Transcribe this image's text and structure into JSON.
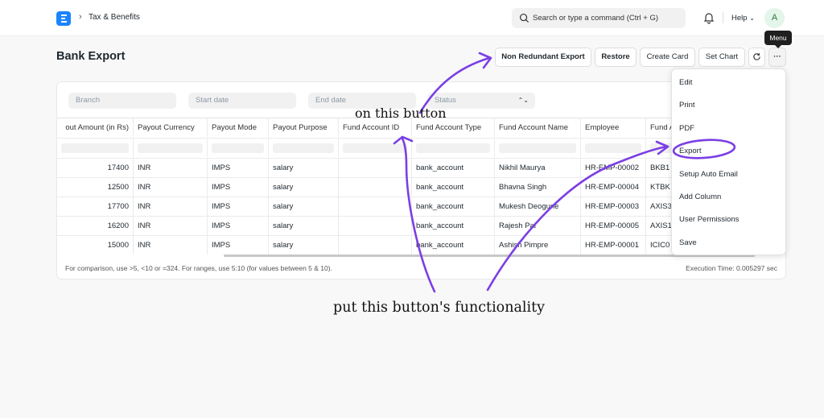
{
  "nav": {
    "breadcrumb": "Tax & Benefits",
    "search_placeholder": "Search or type a command (Ctrl + G)",
    "help_label": "Help",
    "avatar_initial": "A"
  },
  "page": {
    "title": "Bank Export"
  },
  "toolbar": {
    "non_redundant_export": "Non Redundant Export",
    "restore": "Restore",
    "create_card": "Create Card",
    "set_chart": "Set Chart",
    "more_label": "···",
    "tooltip": "Menu"
  },
  "filters": {
    "branch": "Branch",
    "start_date": "Start date",
    "end_date": "End date",
    "status": "Status"
  },
  "table": {
    "columns": [
      "out Amount (in Rs)",
      "Payout Currency",
      "Payout Mode",
      "Payout Purpose",
      "Fund Account ID",
      "Fund Account Type",
      "Fund Account Name",
      "Employee",
      "Fund A"
    ],
    "rows": [
      [
        "17400",
        "INR",
        "IMPS",
        "salary",
        "",
        "bank_account",
        "Nikhil Maurya",
        "HR-EMP-00002",
        "BKB1"
      ],
      [
        "12500",
        "INR",
        "IMPS",
        "salary",
        "",
        "bank_account",
        "Bhavna Singh",
        "HR-EMP-00004",
        "KTBK"
      ],
      [
        "17700",
        "INR",
        "IMPS",
        "salary",
        "",
        "bank_account",
        "Mukesh Deogune",
        "HR-EMP-00003",
        "AXIS3"
      ],
      [
        "16200",
        "INR",
        "IMPS",
        "salary",
        "",
        "bank_account",
        "Rajesh Pal",
        "HR-EMP-00005",
        "AXIS1"
      ],
      [
        "15000",
        "INR",
        "IMPS",
        "salary",
        "",
        "bank_account",
        "Ashish Pimpre",
        "HR-EMP-00001",
        "ICIC0"
      ]
    ]
  },
  "footer": {
    "hint": "For comparison, use >5, <10 or =324. For ranges, use 5:10 (for values between 5 & 10).",
    "execution_time": "Execution Time: 0.005297 sec"
  },
  "menu": {
    "items": [
      "Edit",
      "Print",
      "PDF",
      "Export",
      "Setup Auto Email",
      "Add Column",
      "User Permissions",
      "Save"
    ]
  },
  "annotations": {
    "note1": "on this button",
    "note2": "put this button's functionality",
    "ink_color": "#7b3fe4"
  }
}
